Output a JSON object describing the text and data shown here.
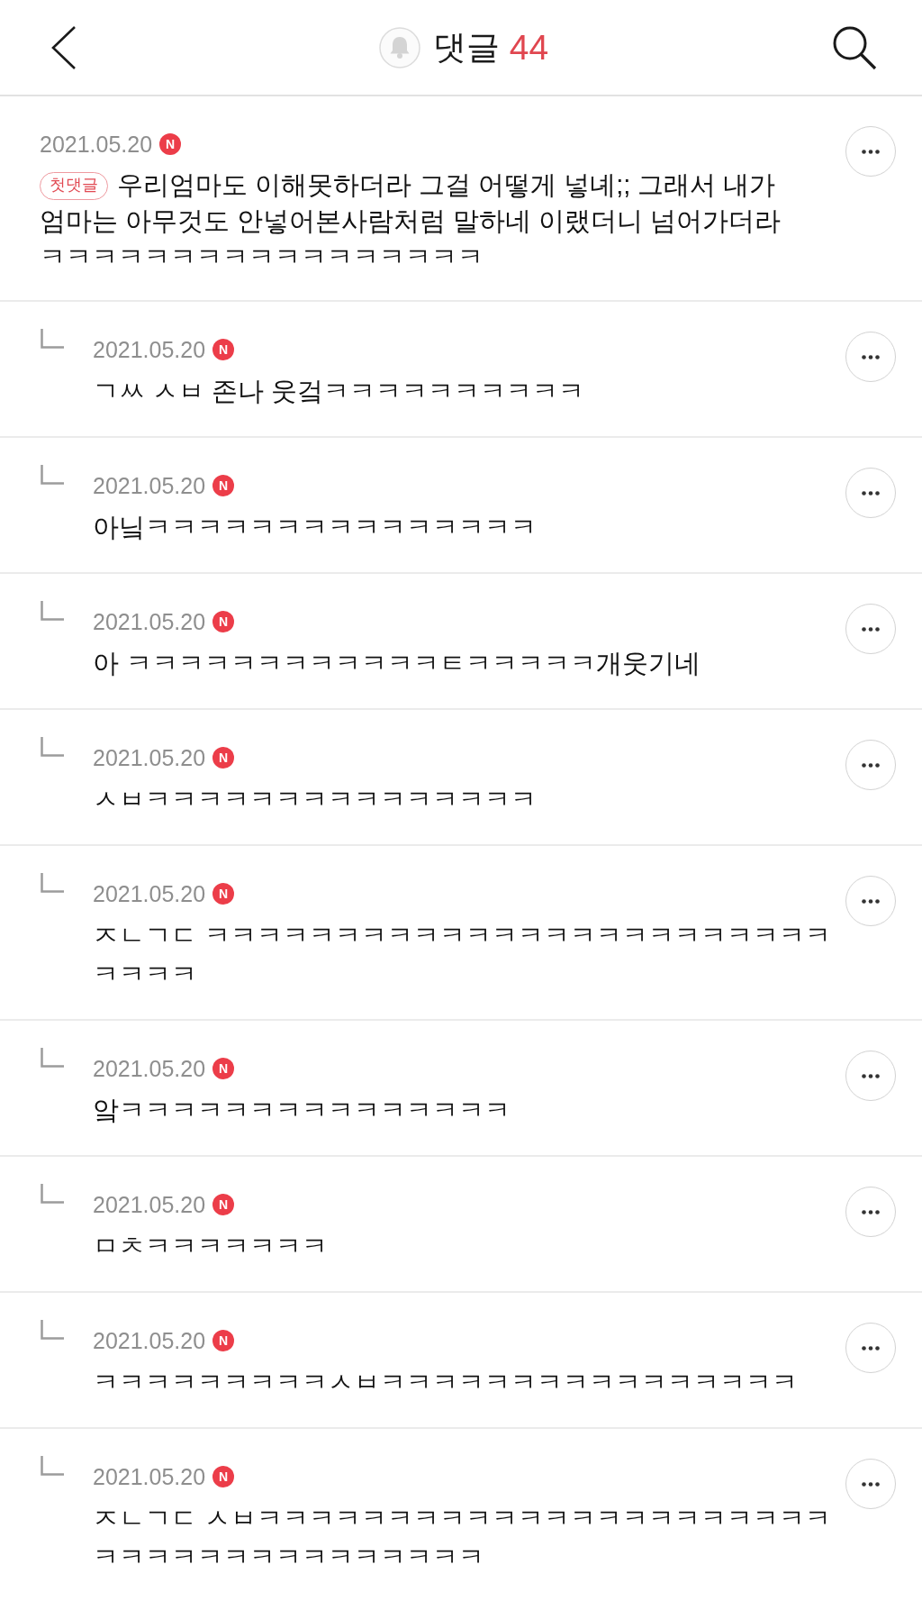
{
  "header": {
    "title": "댓글",
    "count": "44"
  },
  "comments": [
    {
      "kind": "comment",
      "date": "2021.05.20",
      "badge": "N",
      "label": "첫댓글",
      "lines": [
        "우리엄마도 이해못하더라 그걸 어떻게 넣녜;; 그래서 내가",
        "엄마는 아무것도 안넣어본사람처럼 말하네 이랬더니 넘어가더라",
        "ㅋㅋㅋㅋㅋㅋㅋㅋㅋㅋㅋㅋㅋㅋㅋㅋㅋ"
      ]
    },
    {
      "kind": "reply",
      "date": "2021.05.20",
      "badge": "N",
      "text": "ㄱㅆ ㅅㅂ 존나 웃겈ㅋㅋㅋㅋㅋㅋㅋㅋㅋㅋ"
    },
    {
      "kind": "reply",
      "date": "2021.05.20",
      "badge": "N",
      "text": "아닠ㅋㅋㅋㅋㅋㅋㅋㅋㅋㅋㅋㅋㅋㅋㅋ"
    },
    {
      "kind": "reply",
      "date": "2021.05.20",
      "badge": "N",
      "text": "아 ㅋㅋㅋㅋㅋㅋㅋㅋㅋㅋㅋㅋㅌㅋㅋㅋㅋㅋ개웃기네"
    },
    {
      "kind": "reply",
      "date": "2021.05.20",
      "badge": "N",
      "text": "ㅅㅂㅋㅋㅋㅋㅋㅋㅋㅋㅋㅋㅋㅋㅋㅋㅋ"
    },
    {
      "kind": "reply",
      "date": "2021.05.20",
      "badge": "N",
      "text": "ㅈㄴㄱㄷ ㅋㅋㅋㅋㅋㅋㅋㅋㅋㅋㅋㅋㅋㅋㅋㅋㅋㅋㅋㅋㅋㅋㅋㅋㅋㅋㅋㅋ"
    },
    {
      "kind": "reply",
      "date": "2021.05.20",
      "badge": "N",
      "text": "앜ㅋㅋㅋㅋㅋㅋㅋㅋㅋㅋㅋㅋㅋㅋㅋ"
    },
    {
      "kind": "reply",
      "date": "2021.05.20",
      "badge": "N",
      "text": "ㅁㅊㅋㅋㅋㅋㅋㅋㅋ"
    },
    {
      "kind": "reply",
      "date": "2021.05.20",
      "badge": "N",
      "text": "ㅋㅋㅋㅋㅋㅋㅋㅋㅋㅅㅂㅋㅋㅋㅋㅋㅋㅋㅋㅋㅋㅋㅋㅋㅋㅋㅋ"
    },
    {
      "kind": "reply",
      "date": "2021.05.20",
      "badge": "N",
      "text": "ㅈㄴㄱㄷ ㅅㅂㅋㅋㅋㅋㅋㅋㅋㅋㅋㅋㅋㅋㅋㅋㅋㅋㅋㅋㅋㅋㅋㅋㅋㅋㅋㅋㅋㅋㅋㅋㅋㅋㅋㅋㅋㅋㅋ"
    }
  ]
}
